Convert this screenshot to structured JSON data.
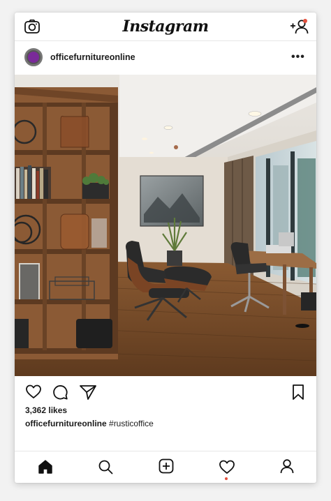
{
  "app": {
    "name": "Instagram"
  },
  "header": {
    "logo_text": "Instagram",
    "left_icon": "camera-icon",
    "right_icon": "add-user-icon",
    "notification_dot_color": "#e3503e"
  },
  "post": {
    "username": "officefurnitureonline",
    "avatar_color": "#7a2a9a",
    "more_icon": "more-horizontal-icon",
    "more_text": "•••",
    "image_description_icon": "photo",
    "likes_text": "3,362 likes",
    "caption": {
      "user": "officefurnitureonline",
      "text": "#rusticoffice"
    },
    "actions": [
      "heart-icon",
      "comment-icon",
      "share-icon",
      "bookmark-icon"
    ]
  },
  "bottom_nav": {
    "items": [
      "home-icon",
      "search-icon",
      "add-post-icon",
      "activity-heart-icon",
      "profile-icon"
    ],
    "active": "home-icon",
    "activity_dot_color": "#e3503e"
  }
}
